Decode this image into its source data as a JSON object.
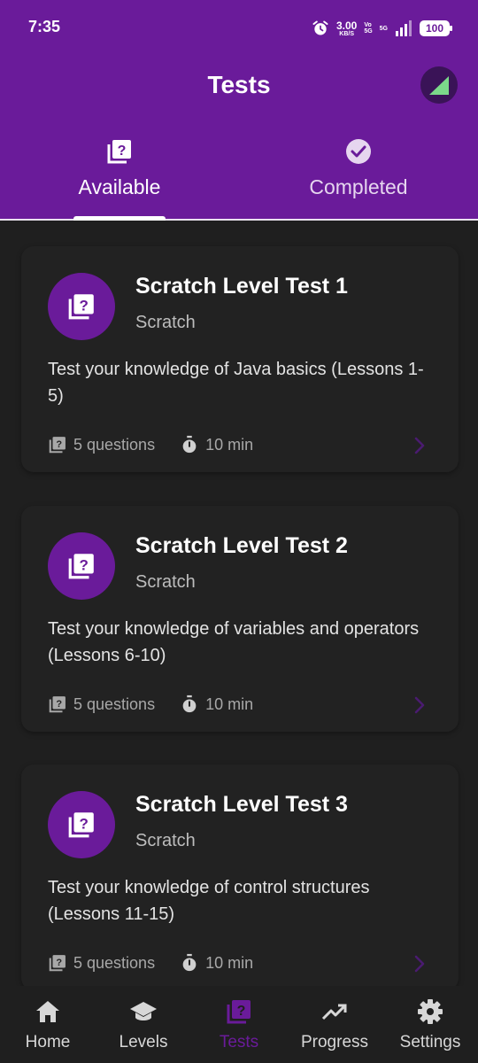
{
  "status_bar": {
    "time": "7:35",
    "net_speed": "3.00",
    "net_unit": "KB/S",
    "vo_top": "Vo",
    "vo_bottom": "5G",
    "net_type": "5G",
    "battery": "100"
  },
  "header": {
    "title": "Tests"
  },
  "tabs": [
    {
      "label": "Available",
      "selected": true,
      "icon": "quiz-icon"
    },
    {
      "label": "Completed",
      "selected": false,
      "icon": "check-circle-icon"
    }
  ],
  "tests": [
    {
      "title": "Scratch Level Test 1",
      "subtitle": "Scratch",
      "description": "Test your knowledge of Java basics (Lessons 1-5)",
      "questions": "5 questions",
      "duration": "10 min"
    },
    {
      "title": "Scratch Level Test 2",
      "subtitle": "Scratch",
      "description": "Test your knowledge of variables and operators (Lessons 6-10)",
      "questions": "5 questions",
      "duration": "10 min"
    },
    {
      "title": "Scratch Level Test 3",
      "subtitle": "Scratch",
      "description": "Test your knowledge of control structures (Lessons 11-15)",
      "questions": "5 questions",
      "duration": "10 min"
    }
  ],
  "bottom_nav": [
    {
      "label": "Home",
      "icon": "home-icon",
      "active": false
    },
    {
      "label": "Levels",
      "icon": "school-icon",
      "active": false
    },
    {
      "label": "Tests",
      "icon": "quiz-icon",
      "active": true
    },
    {
      "label": "Progress",
      "icon": "trending-up-icon",
      "active": false
    },
    {
      "label": "Settings",
      "icon": "gear-icon",
      "active": false
    }
  ],
  "colors": {
    "primary": "#6a1b9a",
    "background": "#1f1f1f",
    "card": "#222222",
    "avatar_accent": "#7bd88a"
  }
}
